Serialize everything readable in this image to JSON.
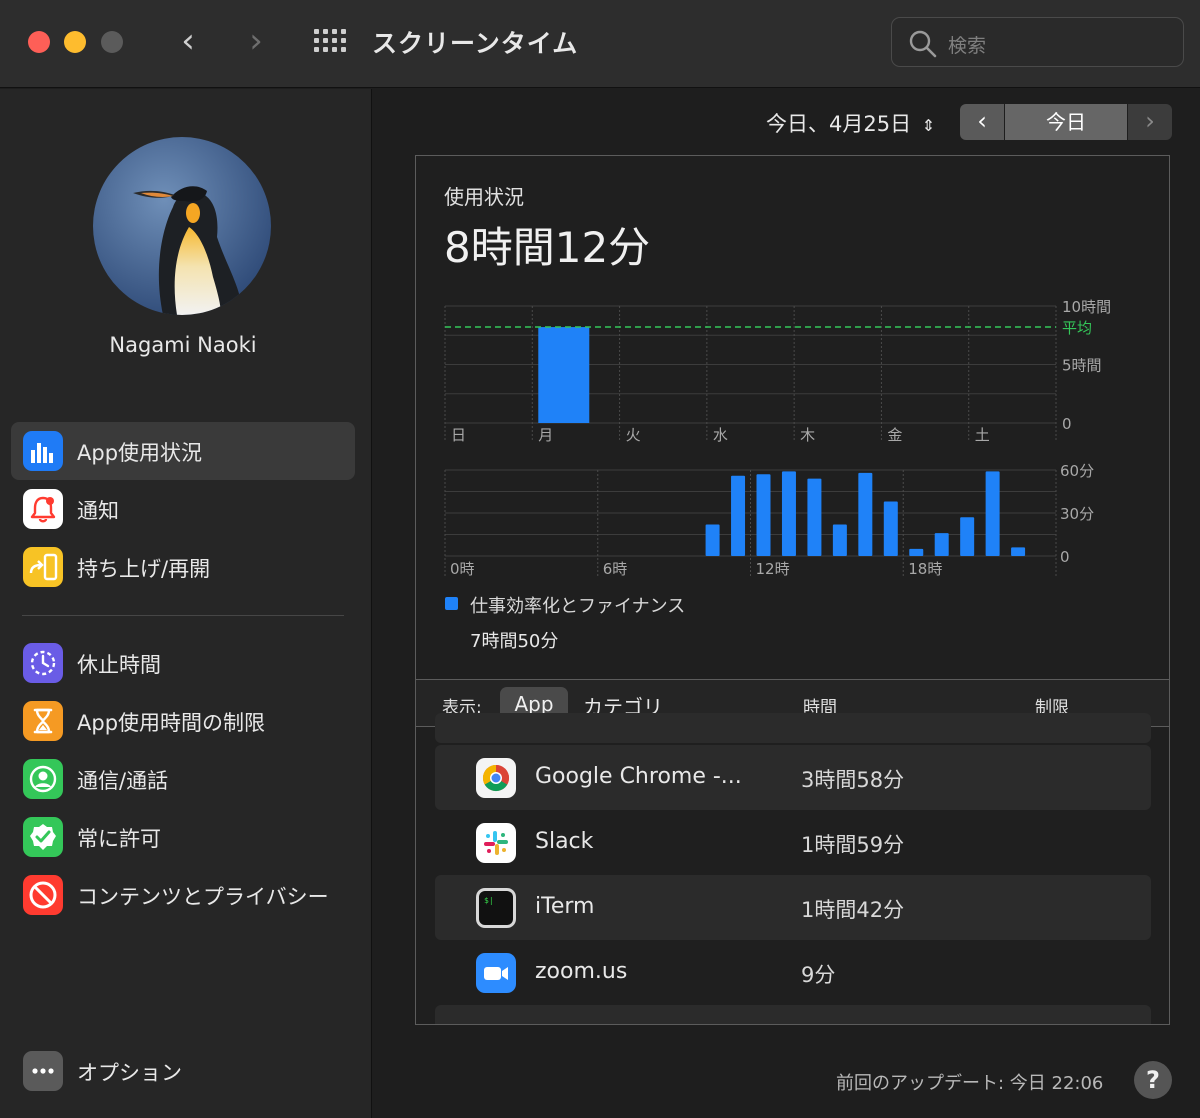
{
  "window": {
    "title": "スクリーンタイム"
  },
  "search": {
    "placeholder": "検索"
  },
  "user": {
    "name": "Nagami Naoki"
  },
  "sidebar": {
    "items": [
      {
        "label": "App使用状況",
        "icon": "bar-chart-icon",
        "color": "#1f7bf6",
        "selected": true
      },
      {
        "label": "通知",
        "icon": "bell-icon",
        "color": "#ffffff"
      },
      {
        "label": "持ち上げ/再開",
        "icon": "pickup-icon",
        "color": "#f7c325"
      }
    ],
    "items2": [
      {
        "label": "休止時間",
        "icon": "downtime-icon",
        "color": "#6a5ce6"
      },
      {
        "label": "App使用時間の制限",
        "icon": "hourglass-icon",
        "color": "#f59a23"
      },
      {
        "label": "通信/通話",
        "icon": "contact-icon",
        "color": "#34c759"
      },
      {
        "label": "常に許可",
        "icon": "check-badge-icon",
        "color": "#34c759"
      },
      {
        "label": "コンテンツとプライバシー",
        "icon": "restriction-icon",
        "color": "#ff3b30"
      }
    ],
    "options": {
      "label": "オプション",
      "icon": "more-icon"
    }
  },
  "datebar": {
    "label": "今日、4月25日",
    "today_button": "今日",
    "prev": "‹",
    "next": "›"
  },
  "usage": {
    "title": "使用状況",
    "total": "8時間12分"
  },
  "chart_data": [
    {
      "type": "bar",
      "categories": [
        "日",
        "月",
        "火",
        "水",
        "木",
        "金",
        "土"
      ],
      "values": [
        0,
        8.2,
        0,
        0,
        0,
        0,
        0
      ],
      "ylim": [
        0,
        10
      ],
      "yticks": [
        "10時間",
        "5時間",
        "0"
      ],
      "average": {
        "label": "平均",
        "value": 8.2,
        "color": "#34c759"
      },
      "bar_color": "#1f82f8"
    },
    {
      "type": "bar",
      "x": [
        0,
        1,
        2,
        3,
        4,
        5,
        6,
        7,
        8,
        9,
        10,
        11,
        12,
        13,
        14,
        15,
        16,
        17,
        18,
        19,
        20,
        21,
        22,
        23
      ],
      "xticks": [
        "0時",
        "6時",
        "12時",
        "18時"
      ],
      "values": [
        0,
        0,
        0,
        0,
        0,
        0,
        0,
        0,
        0,
        0,
        22,
        56,
        57,
        59,
        54,
        22,
        58,
        38,
        5,
        16,
        27,
        59,
        6,
        0
      ],
      "ylim": [
        0,
        60
      ],
      "yticks": [
        "60分",
        "30分",
        "0"
      ],
      "bar_color": "#1f82f8"
    }
  ],
  "legend": {
    "label": "仕事効率化とファイナンス",
    "value": "7時間50分",
    "color": "#1f82f8"
  },
  "table": {
    "show_label": "表示:",
    "app_tab": "App",
    "category_tab": "カテゴリ",
    "time_header": "時間",
    "limit_header": "制限",
    "rows": [
      {
        "name": "Google Chrome -...",
        "time": "3時間58分",
        "icon": "chrome-icon"
      },
      {
        "name": "Slack",
        "time": "1時間59分",
        "icon": "slack-icon"
      },
      {
        "name": "iTerm",
        "time": "1時間42分",
        "icon": "terminal-icon"
      },
      {
        "name": "zoom.us",
        "time": "9分",
        "icon": "zoom-icon"
      }
    ]
  },
  "footer": {
    "last_update": "前回のアップデート: 今日 22:06",
    "help": "?"
  }
}
